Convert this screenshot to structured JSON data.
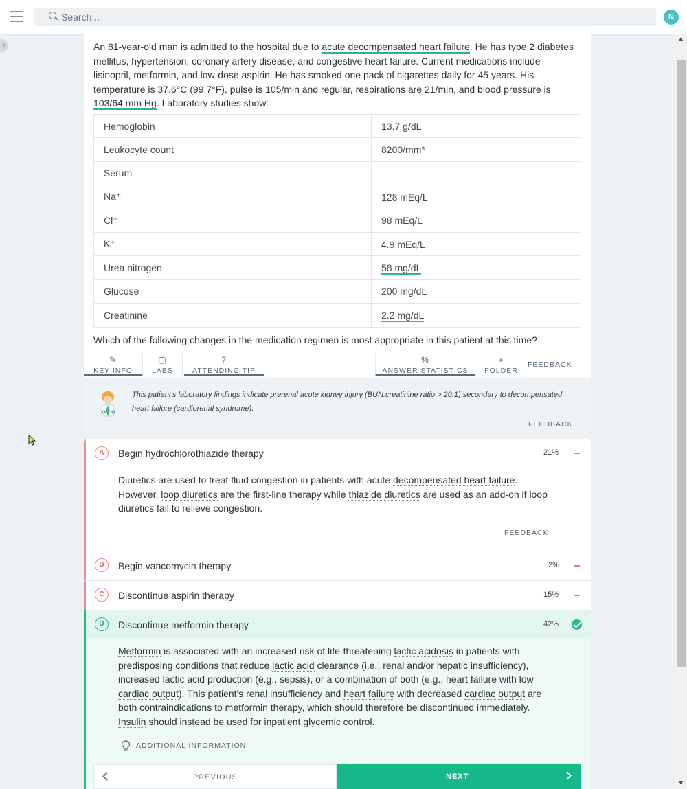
{
  "header": {
    "search_placeholder": "Search...",
    "avatar_initial": "N"
  },
  "question": {
    "stem_p1": "An 81-year-old man is admitted to the hospital due to ",
    "stem_link1": "acute decompensated heart failure",
    "stem_p2": ". He has type 2 diabetes mellitus, hypertension, coronary artery disease, and congestive heart failure. Current medications include lisinopril, metformin, and low-dose aspirin. He has smoked one pack of cigarettes daily for 45 years. His temperature is 37.6°C (99.7°F), pulse is 105/min and regular, respirations are 21/min, and blood pressure is ",
    "stem_link2": "103/64 mm Hg",
    "stem_p3": ". Laboratory studies show:",
    "labs": [
      {
        "name": "Hemoglobin",
        "value": "13.7 g/dL"
      },
      {
        "name": "Leukocyte count",
        "value": "8200/mm³"
      },
      {
        "name": "Serum",
        "value": ""
      },
      {
        "name": "Na⁺",
        "value": "128 mEq/L"
      },
      {
        "name": "Cl⁻",
        "value": "98 mEq/L"
      },
      {
        "name": "K⁺",
        "value": "4.9 mEq/L"
      },
      {
        "name": "Urea nitrogen",
        "value": "58 mg/dL"
      },
      {
        "name": "Glucose",
        "value": "200 mg/dL"
      },
      {
        "name": "Creatinine",
        "value": "2.2 mg/dL"
      }
    ],
    "prompt": "Which of the following changes in the medication regimen is most appropriate in this patient at this time?"
  },
  "tabs": {
    "key_info": "KEY INFO",
    "labs": "LABS",
    "attending_tip": "ATTENDING TIP",
    "answer_statistics": "ANSWER STATISTICS",
    "folder": "FOLDER",
    "feedback": "FEEDBACK",
    "icon_pencil": "✎",
    "icon_labs": "▢",
    "icon_help": "?",
    "icon_percent": "%",
    "icon_plus": "+"
  },
  "tip": {
    "text": "This patient's laboratory findings indicate prerenal acute kidney injury (BUN:creatinine ratio > 20:1) secondary to decompensated heart failure (cardiorenal syndrome).",
    "feedback": "FEEDBACK"
  },
  "answers": [
    {
      "letter": "A",
      "label": "Begin hydrochlorothiazide therapy",
      "pct": "21%"
    },
    {
      "letter": "B",
      "label": "Begin vancomycin therapy",
      "pct": "2%"
    },
    {
      "letter": "C",
      "label": "Discontinue aspirin therapy",
      "pct": "15%"
    },
    {
      "letter": "D",
      "label": "Discontinue metformin therapy",
      "pct": "42%"
    }
  ],
  "explanation_a": {
    "t1": "Diuretics are used to treat fluid congestion in patients with acute ",
    "l1": "decompensated heart failure",
    "t2": ". However, ",
    "l2": "loop diuretics",
    "t3": " are the first-line therapy while ",
    "l3": "thiazide diuretics",
    "t4": " are used as an add-on if loop diuretics fail to relieve congestion.",
    "feedback": "FEEDBACK"
  },
  "explanation_d": {
    "l1": "Metformin",
    "t1": " is associated with an increased risk of life-threatening ",
    "l2": "lactic acidosis",
    "t2": " in patients with predisposing conditions that reduce ",
    "l3": "lactic acid",
    "t3": " clearance (i.e., renal and/or hepatic insufficiency), increased ",
    "l4": "lactic acid",
    "t4": " production (e.g., ",
    "l5": "sepsis",
    "t5": "), or a combination of both (e.g., ",
    "l6": "heart failure",
    "t6": " with low ",
    "l7": "cardiac output",
    "t7": "). This patient's renal insufficiency and ",
    "l8": "heart failure",
    "t8": " with decreased ",
    "l9": "cardiac output",
    "t9": " are both contraindications to ",
    "l10": "metformin",
    "t10": " therapy, which should therefore be discontinued immediately. ",
    "l11": "Insulin",
    "t11": " should instead be used for inpatient glycemic control.",
    "additional": "ADDITIONAL INFORMATION"
  },
  "nav": {
    "previous": "PREVIOUS",
    "next": "NEXT"
  },
  "colors": {
    "accent_green": "#16b98a",
    "incorrect_red": "#f08a8a",
    "avatar": "#4cc0c9"
  }
}
